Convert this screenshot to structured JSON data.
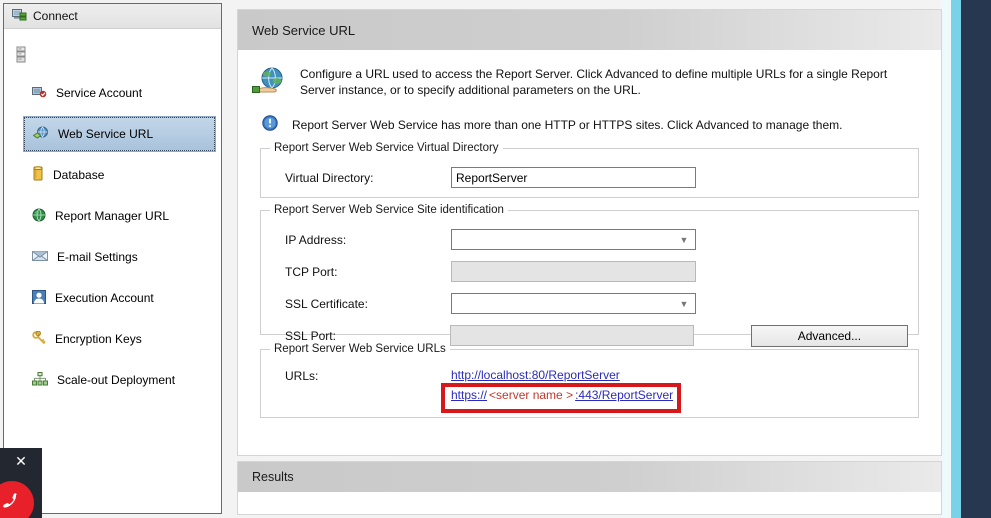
{
  "sidebar": {
    "header_label": "Connect",
    "header_icon": "server-connect-icon",
    "server_node_icon": "server-stack-icon",
    "items": [
      {
        "label": "Service Account",
        "icon": "service-account-icon",
        "selected": false
      },
      {
        "label": "Web Service URL",
        "icon": "web-service-url-icon",
        "selected": true
      },
      {
        "label": "Database",
        "icon": "database-icon",
        "selected": false
      },
      {
        "label": "Report Manager URL",
        "icon": "globe-icon",
        "selected": false
      },
      {
        "label": "E-mail Settings",
        "icon": "envelope-icon",
        "selected": false
      },
      {
        "label": "Execution Account",
        "icon": "user-account-icon",
        "selected": false
      },
      {
        "label": "Encryption Keys",
        "icon": "keys-icon",
        "selected": false
      },
      {
        "label": "Scale-out Deployment",
        "icon": "scale-out-icon",
        "selected": false
      }
    ]
  },
  "main": {
    "title": "Web Service URL",
    "description": "Configure a URL used to access the Report Server.  Click Advanced to define multiple URLs for a single Report Server instance, or to specify additional parameters on the URL.",
    "info_message": "Report Server Web Service has more than one HTTP or HTTPS sites. Click Advanced to manage them.",
    "virtual_directory_group": {
      "legend": "Report Server Web Service Virtual Directory",
      "label": "Virtual Directory:",
      "value": "ReportServer"
    },
    "site_identification_group": {
      "legend": "Report Server Web Service Site identification",
      "ip_address_label": "IP Address:",
      "ip_address_value": "",
      "tcp_port_label": "TCP Port:",
      "tcp_port_value": "",
      "ssl_certificate_label": "SSL Certificate:",
      "ssl_certificate_value": "",
      "ssl_port_label": "SSL Port:",
      "ssl_port_value": "",
      "advanced_button": "Advanced..."
    },
    "urls_group": {
      "legend": "Report Server Web Service URLs",
      "label": "URLs:",
      "url_1": "http://localhost:80/ReportServer",
      "url_2_scheme": "https://",
      "url_2_server": "<server name >",
      "url_2_rest": ":443/ReportServer",
      "highlight_color": "#d8171b"
    }
  },
  "results": {
    "title": "Results"
  },
  "call_overlay": {
    "close_glyph": "✕",
    "hangup_icon": "hangup-phone-icon",
    "hangup_color": "#e8202a"
  },
  "chrome": {
    "cyan_color": "#79d2e8",
    "navy_color": "#27374f"
  }
}
